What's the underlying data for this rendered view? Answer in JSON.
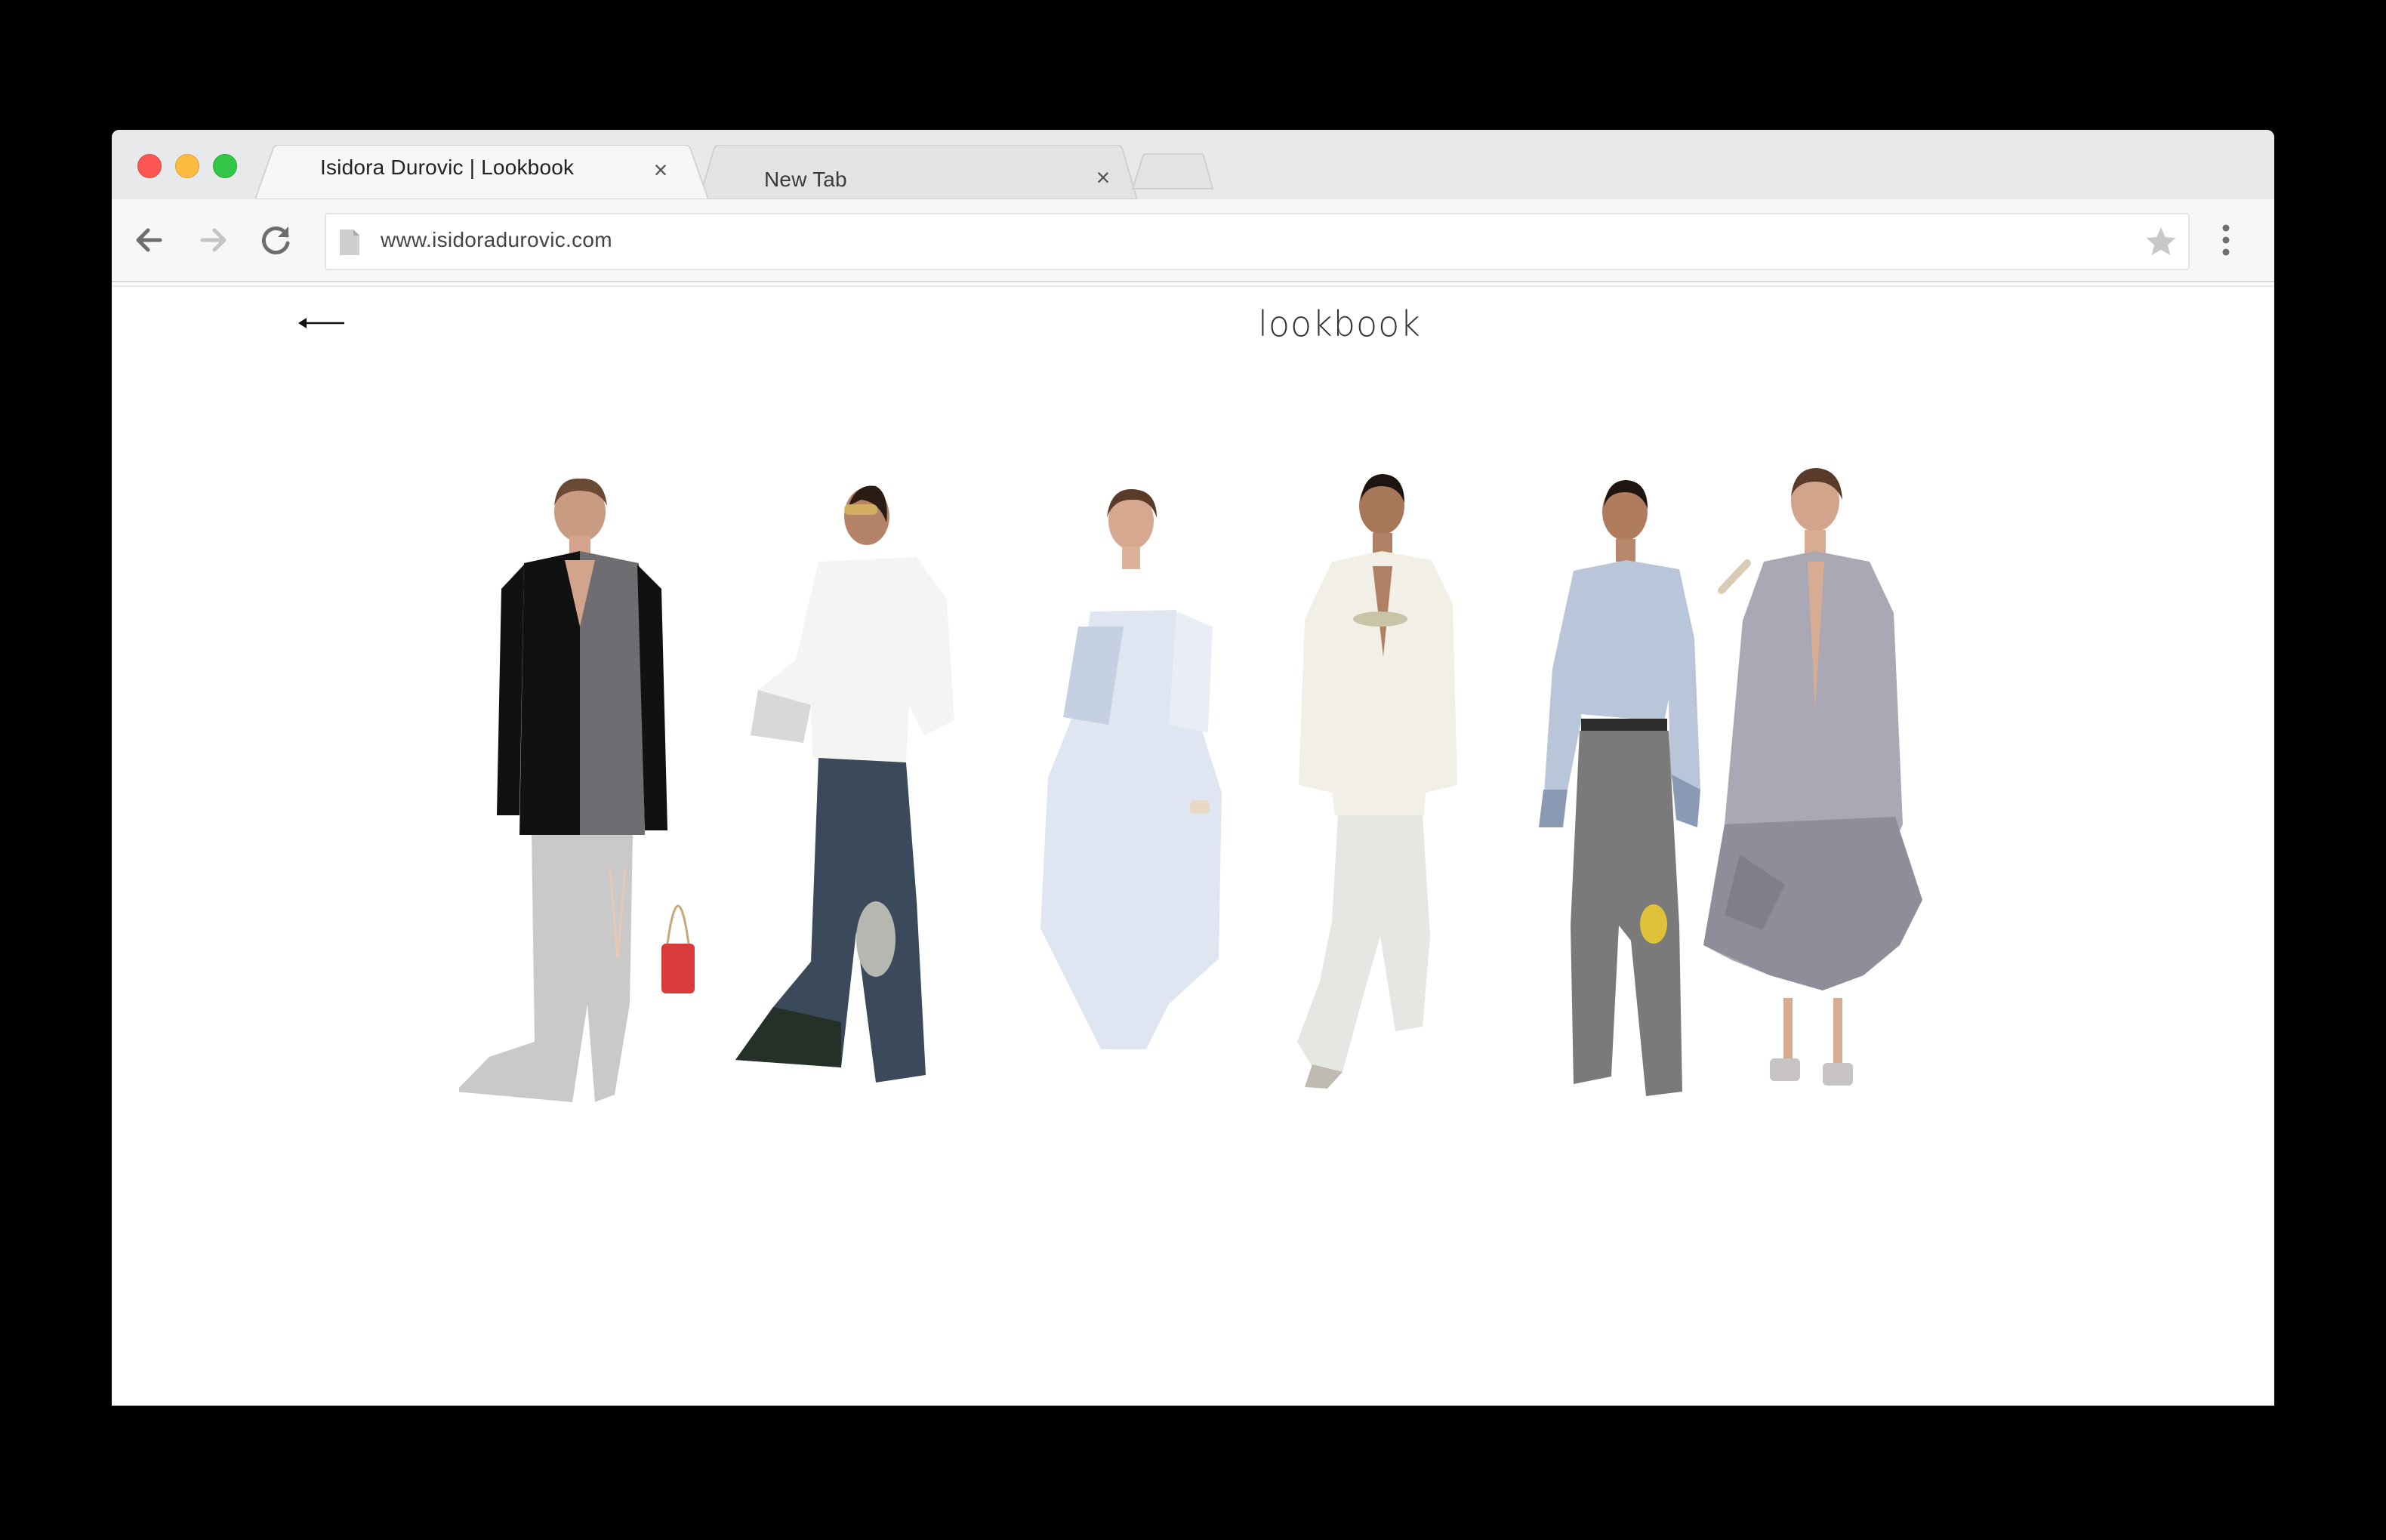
{
  "browser": {
    "tabs": [
      {
        "title": "Isidora Durovic | Lookbook",
        "active": true
      },
      {
        "title": "New Tab",
        "active": false
      }
    ],
    "address": "www.isidoradurovic.com",
    "icons": {
      "back": "arrow-left-icon",
      "forward": "arrow-right-icon",
      "reload": "reload-icon",
      "page": "page-icon",
      "bookmark": "star-icon",
      "menu": "more-vertical-icon",
      "close": "close-icon"
    }
  },
  "page": {
    "title": "lookbook",
    "back_icon": "long-arrow-left-icon",
    "looks": [
      {
        "id": 1,
        "description": "black and grey split blazer with grey wide trousers and red mini bag",
        "colors": {
          "top": "#111111",
          "accent": "#6d6d72",
          "bottom": "#c9c9c9",
          "bag": "#d93a3a"
        }
      },
      {
        "id": 2,
        "description": "white oversized shirt with draped denim-like trousers",
        "colors": {
          "top": "#f4f4f2",
          "accent": "#d8d8d8",
          "bottom": "#3a4a5a",
          "bag": "#b7b7b2"
        }
      },
      {
        "id": 3,
        "description": "pale blue sculptural strapless dress",
        "colors": {
          "top": "#dfe6f2",
          "accent": "#c5d0e3",
          "bottom": "#e8edf6",
          "bag": "#e9d9c4"
        }
      },
      {
        "id": 4,
        "description": "ivory blazer with white crinkled trousers",
        "colors": {
          "top": "#f1efe6",
          "accent": "#c9c3a8",
          "bottom": "#e6e6e3",
          "bag": "#bfbab2"
        }
      },
      {
        "id": 5,
        "description": "light blue shirt with grey wide-leg trousers and yellow mini bag",
        "colors": {
          "top": "#b9c5d8",
          "accent": "#8a9ab3",
          "bottom": "#7a7a7a",
          "bag": "#e0c23a"
        }
      },
      {
        "id": 6,
        "description": "lilac grey long coat with tie-dye hem",
        "colors": {
          "top": "#a9a8b4",
          "accent": "#77747f",
          "bottom": "#8f8d99",
          "bag": "#c8c4c4"
        }
      }
    ]
  }
}
